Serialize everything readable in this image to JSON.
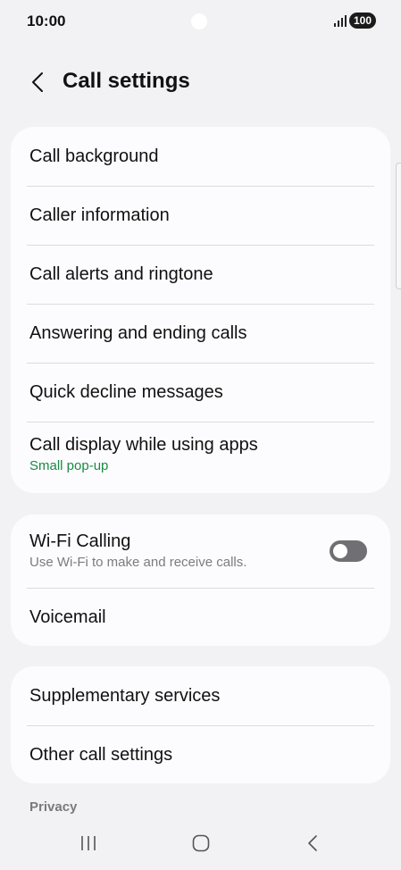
{
  "status_bar": {
    "time": "10:00",
    "battery": "100",
    "signal_icon": "signal-bars-icon"
  },
  "header": {
    "back_icon": "chevron-left-icon",
    "title": "Call settings"
  },
  "card1": {
    "items": [
      {
        "label": "Call background"
      },
      {
        "label": "Caller information"
      },
      {
        "label": "Call alerts and ringtone"
      },
      {
        "label": "Answering and ending calls"
      },
      {
        "label": "Quick decline messages"
      },
      {
        "label": "Call display while using apps",
        "sub": "Small pop-up"
      }
    ]
  },
  "card2": {
    "wifi_calling": {
      "label": "Wi-Fi Calling",
      "sub": "Use Wi-Fi to make and receive calls.",
      "toggle_on": false
    },
    "voicemail": {
      "label": "Voicemail"
    }
  },
  "card3": {
    "items": [
      {
        "label": "Supplementary services"
      },
      {
        "label": "Other call settings"
      }
    ]
  },
  "section": {
    "privacy_label": "Privacy"
  },
  "nav": {
    "recents_icon": "recent-apps-icon",
    "home_icon": "home-icon",
    "back_icon": "back-icon"
  },
  "colors": {
    "background": "#f2f2f4",
    "card": "#fcfcfe",
    "accent_green": "#198a40",
    "subtext_gray": "#7c7c80"
  }
}
